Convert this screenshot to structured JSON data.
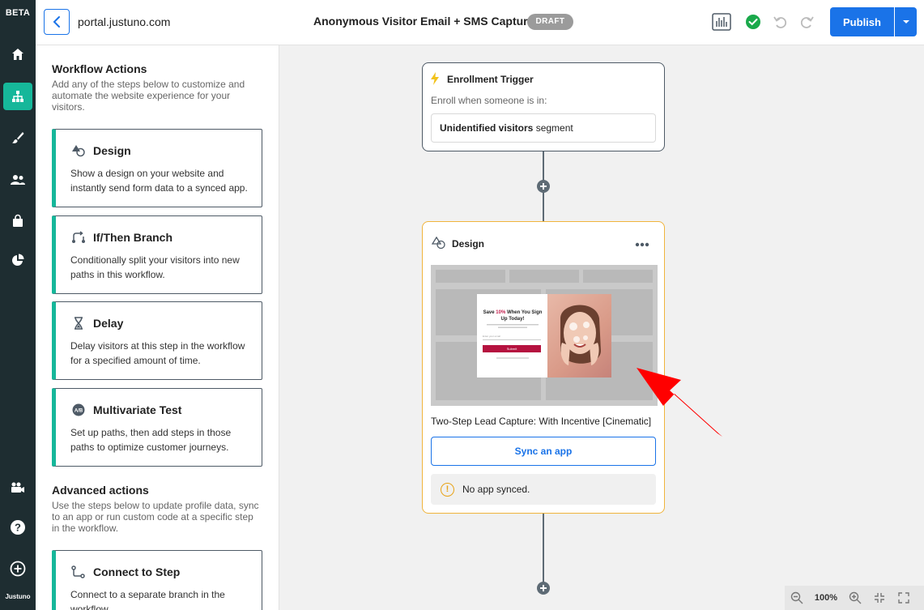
{
  "rail": {
    "badge": "BETA",
    "items": [
      {
        "icon": "home-icon"
      },
      {
        "icon": "workflow-icon",
        "active": true
      },
      {
        "icon": "brush-icon"
      },
      {
        "icon": "users-icon"
      },
      {
        "icon": "shopping-bag-icon"
      },
      {
        "icon": "pie-chart-icon"
      }
    ],
    "bottom_items": [
      {
        "icon": "video-camera-icon"
      },
      {
        "icon": "help-icon"
      },
      {
        "icon": "add-icon"
      }
    ],
    "logo": "Justuno"
  },
  "topbar": {
    "url": "portal.justuno.com",
    "title": "Anonymous Visitor Email + SMS Capture",
    "status_badge": "DRAFT",
    "publish_label": "Publish"
  },
  "panel": {
    "workflow_actions": {
      "title": "Workflow Actions",
      "description": "Add any of the steps below to customize and automate the website experience for your visitors.",
      "cards": [
        {
          "icon": "shapes-icon",
          "title": "Design",
          "description": "Show a design on your website and instantly send form data to a synced app."
        },
        {
          "icon": "branch-icon",
          "title": "If/Then Branch",
          "description": "Conditionally split your visitors into new paths in this workflow."
        },
        {
          "icon": "hourglass-icon",
          "title": "Delay",
          "description": "Delay visitors at this step in the workflow for a specified amount of time."
        },
        {
          "icon": "ab-test-icon",
          "title": "Multivariate Test",
          "description": "Set up paths, then add steps in those paths to optimize customer journeys."
        }
      ]
    },
    "advanced_actions": {
      "title": "Advanced actions",
      "description": "Use the steps below to update profile data, sync to an app or run custom code at a specific step in the workflow.",
      "cards": [
        {
          "icon": "connect-icon",
          "title": "Connect to Step",
          "description": "Connect to a separate branch in the workflow."
        }
      ]
    }
  },
  "canvas": {
    "trigger": {
      "title": "Enrollment Trigger",
      "description": "Enroll when someone is in:",
      "segment_bold": "Unidentified visitors",
      "segment_rest": " segment"
    },
    "design_node": {
      "title": "Design",
      "design_name": "Two-Step Lead Capture: With Incentive [Cinematic]",
      "sync_label": "Sync an app",
      "no_sync_text": "No app synced.",
      "preview": {
        "headline_a": "Save ",
        "headline_pct": "10%",
        "headline_b": " When You Sign Up Today!",
        "input_placeholder": "Enter your email",
        "button": "Submit"
      }
    },
    "zoom": "100%"
  },
  "colors": {
    "rail_bg": "#1e2d31",
    "accent_teal": "#16b79a",
    "primary_blue": "#1a73e8",
    "node_border_design": "#f0b43c",
    "arrow_red": "#ff0000"
  }
}
